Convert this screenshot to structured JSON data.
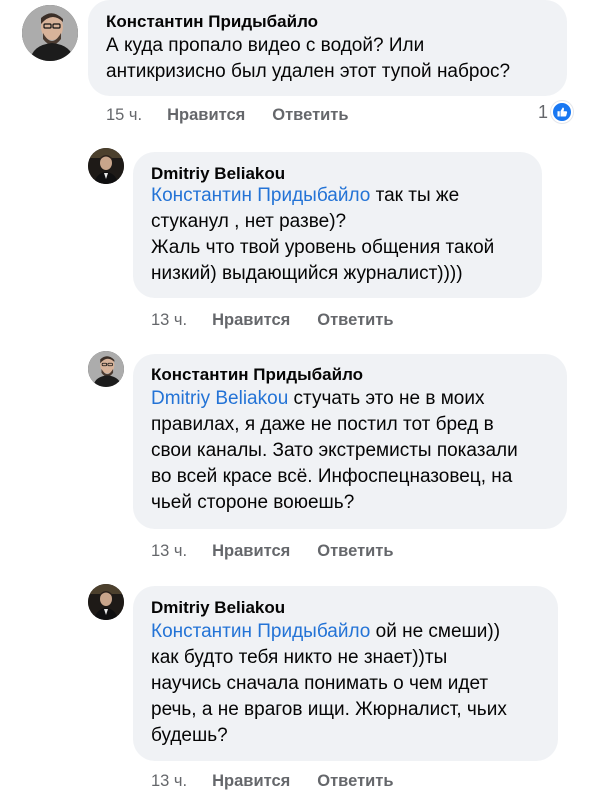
{
  "comments": [
    {
      "author": "Константин Придыбайло",
      "lines": [
        "А куда пропало видео с водой? Или",
        "антикризисно был удален этот тупой наброс?"
      ],
      "time": "15 ч.",
      "like_label": "Нравится",
      "reply_label": "Ответить",
      "reactions_count": "1",
      "reaction_icon": "like-icon"
    },
    {
      "author": "Dmitriy Beliakou",
      "mention": "Константин Придыбайло",
      "lines_after_mention": " так ты же",
      "lines": [
        "стуканул , нет разве)?",
        "Жаль что твой уровень общения такой",
        "низкий) выдающийся журналист))))"
      ],
      "time": "13 ч.",
      "like_label": "Нравится",
      "reply_label": "Ответить"
    },
    {
      "author": "Константин Придыбайло",
      "mention": "Dmitriy Beliakou",
      "lines_after_mention": " стучать это не в моих",
      "lines": [
        "правилах, я даже не постил тот бред в",
        "свои каналы. Зато экстремисты показали",
        "во всей красе всё. Инфоспецназовец, на",
        "чьей стороне воюешь?"
      ],
      "time": "13 ч.",
      "like_label": "Нравится",
      "reply_label": "Ответить"
    },
    {
      "author": "Dmitriy Beliakou",
      "mention": "Константин Придыбайло",
      "lines_after_mention": " ой не смеши))",
      "lines": [
        "как будто тебя никто не знает))ты",
        "научись сначала понимать о чем идет",
        "речь, а не врагов ищи. Жюрналист, чьих",
        "будешь?"
      ],
      "time": "13 ч.",
      "like_label": "Нравится",
      "reply_label": "Ответить"
    }
  ],
  "colors": {
    "bubble": "#f0f2f5",
    "mention": "#2373d6",
    "meta": "#65676b",
    "like_badge": "#1877f2"
  }
}
